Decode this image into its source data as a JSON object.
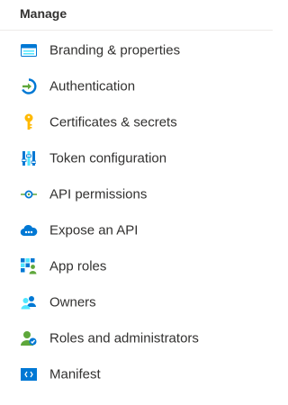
{
  "section": {
    "title": "Manage"
  },
  "nav": {
    "items": [
      {
        "label": "Branding & properties",
        "icon": "branding-window-icon"
      },
      {
        "label": "Authentication",
        "icon": "authentication-arrow-icon"
      },
      {
        "label": "Certificates & secrets",
        "icon": "key-icon"
      },
      {
        "label": "Token configuration",
        "icon": "token-bars-icon"
      },
      {
        "label": "API permissions",
        "icon": "api-permissions-icon"
      },
      {
        "label": "Expose an API",
        "icon": "cloud-icon"
      },
      {
        "label": "App roles",
        "icon": "grid-users-icon"
      },
      {
        "label": "Owners",
        "icon": "owners-users-icon"
      },
      {
        "label": "Roles and administrators",
        "icon": "admin-user-icon"
      },
      {
        "label": "Manifest",
        "icon": "manifest-code-icon"
      }
    ]
  },
  "colors": {
    "blue": "#0078d4",
    "light_blue": "#50e6ff",
    "green": "#5ea73b",
    "gold": "#ffb900",
    "text": "#323130"
  }
}
